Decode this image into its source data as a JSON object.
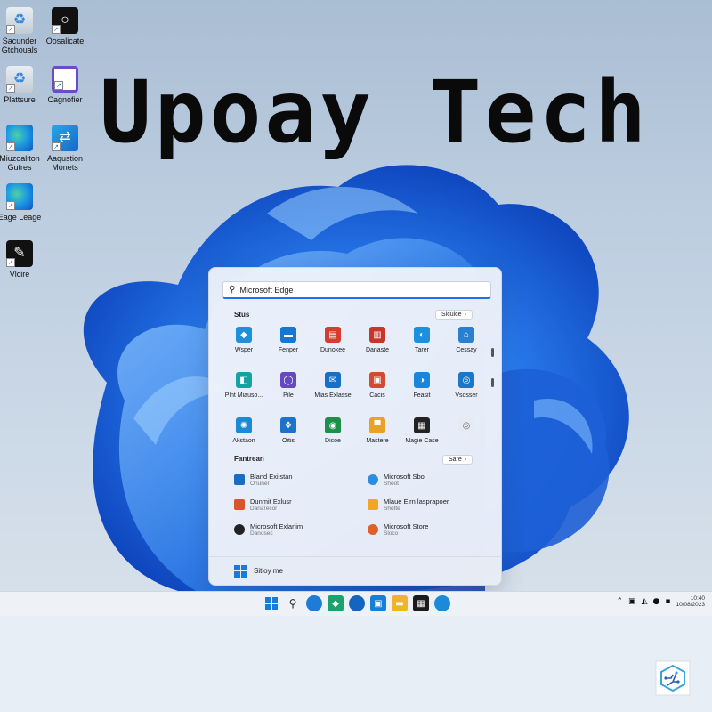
{
  "headline": "Upoay Tech",
  "desktop_icons": [
    {
      "label": "Sacunder Gtchouals",
      "icon": "recycle-bin-icon"
    },
    {
      "label": "Oosalicate",
      "icon": "dark-app-icon"
    },
    {
      "label": "Plattsure",
      "icon": "recycle-bin-icon"
    },
    {
      "label": "Cagnofier",
      "icon": "purple-circle-icon"
    },
    {
      "label": "Miuzoaliton Gutres",
      "icon": "edge-icon"
    },
    {
      "label": "Aaqustion Monets",
      "icon": "app-tile-icon"
    },
    {
      "label": "Eage Leage",
      "icon": "edge-icon"
    },
    {
      "label": "Vlcire",
      "icon": "dark-app-icon"
    }
  ],
  "start_menu": {
    "search_value": "Microsoft Edge",
    "pinned_title": "Stus",
    "pinned_button": "Sicuice",
    "pinned": [
      {
        "label": "Wsper",
        "color": "#1e8fd8",
        "glyph": "◆"
      },
      {
        "label": "Fenper",
        "color": "#1577d4",
        "glyph": "▬"
      },
      {
        "label": "Dunokee",
        "color": "#d93c2e",
        "glyph": "▤"
      },
      {
        "label": "Danaste",
        "color": "#c9352b",
        "glyph": "▥"
      },
      {
        "label": "Tarer",
        "color": "#1a90e0",
        "glyph": "◐"
      },
      {
        "label": "Cessay",
        "color": "#2b7fd0",
        "glyph": "⌂"
      },
      {
        "label": "Plnt Miauso...",
        "color": "#13a3a0",
        "glyph": "◧"
      },
      {
        "label": "Pile",
        "color": "#6648c2",
        "glyph": "◯"
      },
      {
        "label": "Mias Exlasse",
        "color": "#1670c8",
        "glyph": "✉"
      },
      {
        "label": "Cacis",
        "color": "#d24a32",
        "glyph": "▣"
      },
      {
        "label": "Feasit",
        "color": "#1986dc",
        "glyph": "◑"
      },
      {
        "label": "Vsosser",
        "color": "#1c77c9",
        "glyph": "◎"
      },
      {
        "label": "Akstaon",
        "color": "#1a8ad4",
        "glyph": "✺"
      },
      {
        "label": "Oitis",
        "color": "#1e73c8",
        "glyph": "❖"
      },
      {
        "label": "Dicoe",
        "color": "#1c8f4a",
        "glyph": "◉"
      },
      {
        "label": "Mastere",
        "color": "#e8a325",
        "glyph": "▀"
      },
      {
        "label": "Magie Case",
        "color": "#222222",
        "glyph": "▦"
      },
      {
        "label": "",
        "color": "#e6ebf2",
        "glyph": "◎"
      }
    ],
    "recommended_title": "Fantrean",
    "recommended_button": "Sare",
    "recommended": [
      {
        "title": "Bland Exilstan",
        "sub": "Onuner",
        "color": "#1a6cc4"
      },
      {
        "title": "Microsoft Sbo",
        "sub": "Shoot",
        "color": "#2f8de0"
      },
      {
        "title": "Dunmit Exlusr",
        "sub": "Danarecor",
        "color": "#d9532e"
      },
      {
        "title": "Mlaue Elrn lasprapoer",
        "sub": "Shotte",
        "color": "#f0a81e"
      },
      {
        "title": "Microsoft Exlanim",
        "sub": "Danosec",
        "color": "#222222"
      },
      {
        "title": "Microsoft Store",
        "sub": "Sloco",
        "color": "#e0602a"
      }
    ],
    "footer_label": "Sitloy me"
  },
  "taskbar": {
    "clock_time": "10:40",
    "clock_date": "10/08/2023"
  }
}
